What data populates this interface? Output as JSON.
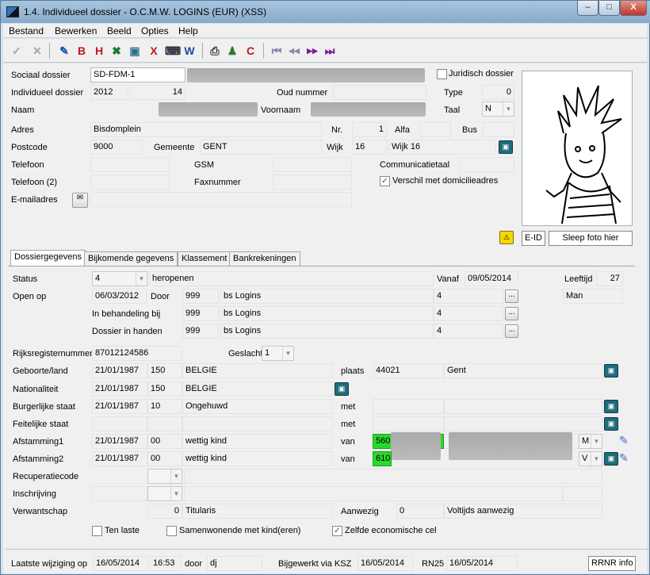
{
  "window": {
    "title": "1.4. Individueel dossier - O.C.M.W. LOGINS (EUR) (XSS)",
    "minimize": "–",
    "maximize": "□",
    "close": "X"
  },
  "menu": [
    "Bestand",
    "Bewerken",
    "Beeld",
    "Opties",
    "Help"
  ],
  "toolbar": [
    {
      "name": "confirm-icon",
      "glyph": "✓",
      "color": "#9aa"
    },
    {
      "name": "cancel-icon",
      "glyph": "✕",
      "color": "#9aa"
    },
    {
      "name": "edit-icon",
      "glyph": "✎",
      "color": "#1a4fb0"
    },
    {
      "name": "b-icon",
      "glyph": "B",
      "color": "#c01818"
    },
    {
      "name": "h-icon",
      "glyph": "H",
      "color": "#c01818"
    },
    {
      "name": "excel-icon",
      "glyph": "✖",
      "color": "#1b7a2a"
    },
    {
      "name": "search-card-icon",
      "glyph": "▣",
      "color": "#2d6f8a"
    },
    {
      "name": "x-icon",
      "glyph": "X",
      "color": "#b51a1a"
    },
    {
      "name": "keyboard-icon",
      "glyph": "⌨",
      "color": "#334"
    },
    {
      "name": "word-icon",
      "glyph": "W",
      "color": "#1f4aa0"
    },
    {
      "name": "printer-icon",
      "glyph": "⎙",
      "color": "#333"
    },
    {
      "name": "person-icon",
      "glyph": "♟",
      "color": "#2c7a2c"
    },
    {
      "name": "c-icon",
      "glyph": "C",
      "color": "#c01818"
    },
    {
      "name": "first-icon",
      "glyph": "⏮",
      "color": "#8a8aa8"
    },
    {
      "name": "prev-icon",
      "glyph": "◀◀",
      "color": "#8a8aa8"
    },
    {
      "name": "next-icon",
      "glyph": "▶▶",
      "color": "#7a1a9a"
    },
    {
      "name": "last-icon",
      "glyph": "⏭",
      "color": "#7a1a9a"
    }
  ],
  "header": {
    "sociaal_dossier_label": "Sociaal dossier",
    "sociaal_dossier": "SD-FDM-1",
    "juridisch_label": "Juridisch dossier",
    "individueel_label": "Individueel dossier",
    "year": "2012",
    "number": "14",
    "oud_nummer_label": "Oud nummer",
    "type_label": "Type",
    "type": "0",
    "naam_label": "Naam",
    "voornaam_label": "Voornaam",
    "taal_label": "Taal",
    "taal": "N",
    "adres_label": "Adres",
    "adres": "Bisdomplein",
    "nr_label": "Nr.",
    "nr": "1",
    "alfa_label": "Alfa",
    "bus_label": "Bus",
    "postcode_label": "Postcode",
    "postcode": "9000",
    "gemeente_label": "Gemeente",
    "gemeente": "GENT",
    "wijk_label": "Wijk",
    "wijk": "16",
    "wijk_name": "Wijk 16",
    "telefoon_label": "Telefoon",
    "gsm_label": "GSM",
    "communicatietaal_label": "Communicatietaal",
    "telefoon2_label": "Telefoon (2)",
    "faxnummer_label": "Faxnummer",
    "verschil_label": "Verschil met domicilieadres",
    "email_label": "E-mailadres",
    "eid_label": "E-ID",
    "sleep_foto_label": "Sleep foto hier"
  },
  "tabs": [
    "Dossiergegevens",
    "Bijkomende gegevens",
    "Klassement",
    "Bankrekeningen"
  ],
  "dossier": {
    "status_label": "Status",
    "status_code": "4",
    "status_text": "heropenen",
    "vanaf_label": "Vanaf",
    "vanaf": "09/05/2014",
    "leeftijd_label": "Leeftijd",
    "leeftijd": "27",
    "open_op_label": "Open op",
    "open_op": "06/03/2012",
    "door_label": "Door",
    "door_code": "999",
    "door_name": "bs Logins",
    "door_num": "4",
    "geslacht_text": "Man",
    "behandeling_label": "In behandeling bij",
    "behandeling_code": "999",
    "behandeling_name": "bs Logins",
    "behandeling_num": "4",
    "handen_label": "Dossier in handen",
    "handen_code": "999",
    "handen_name": "bs Logins",
    "handen_num": "4",
    "rijksregister_label": "Rijksregisternummer",
    "rijksregister": "87012124586",
    "geslacht_label": "Geslacht",
    "geslacht": "1",
    "geboorte_label": "Geboorte/land",
    "geboorte_date": "21/01/1987",
    "geboorte_code": "150",
    "geboorte_land": "BELGIE",
    "plaats_label": "plaats",
    "plaats_code": "44021",
    "plaats": "Gent",
    "nationaliteit_label": "Nationaliteit",
    "nat_date": "21/01/1987",
    "nat_code": "150",
    "nat_land": "BELGIE",
    "burger_label": "Burgerlijke staat",
    "burger_date": "21/01/1987",
    "burger_code": "10",
    "burger_text": "Ongehuwd",
    "met_label": "met",
    "feitelijke_label": "Feitelijke staat",
    "afst1_label": "Afstamming1",
    "afst1_date": "21/01/1987",
    "afst1_code": "00",
    "afst1_text": "wettig kind",
    "van_label": "van",
    "afst1_van": "560",
    "afst1_gender": "M",
    "afst2_label": "Afstamming2",
    "afst2_date": "21/01/1987",
    "afst2_code": "00",
    "afst2_text": "wettig kind",
    "afst2_van": "610",
    "afst2_gender": "V",
    "recup_label": "Recuperatiecode",
    "inschrijving_label": "Inschrijving",
    "verwantschap_label": "Verwantschap",
    "verwantschap_code": "0",
    "verwantschap_text": "Titularis",
    "aanwezig_label": "Aanwezig",
    "aanwezig_code": "0",
    "aanwezig_text": "Voltijds aanwezig",
    "ten_laste_label": "Ten laste",
    "samenwonende_label": "Samenwonende met kind(eren)",
    "zelfde_label": "Zelfde economische cel"
  },
  "status": {
    "laatste_label": "Laatste wijziging op",
    "laatste_date": "16/05/2014",
    "laatste_time": "16:53",
    "door_label": "door",
    "door": "dj",
    "ksz_label": "Bijgewerkt via KSZ",
    "ksz_date": "16/05/2014",
    "rn25_label": "RN25",
    "rn25_date": "16/05/2014",
    "rrnr_label": "RRNR info"
  }
}
